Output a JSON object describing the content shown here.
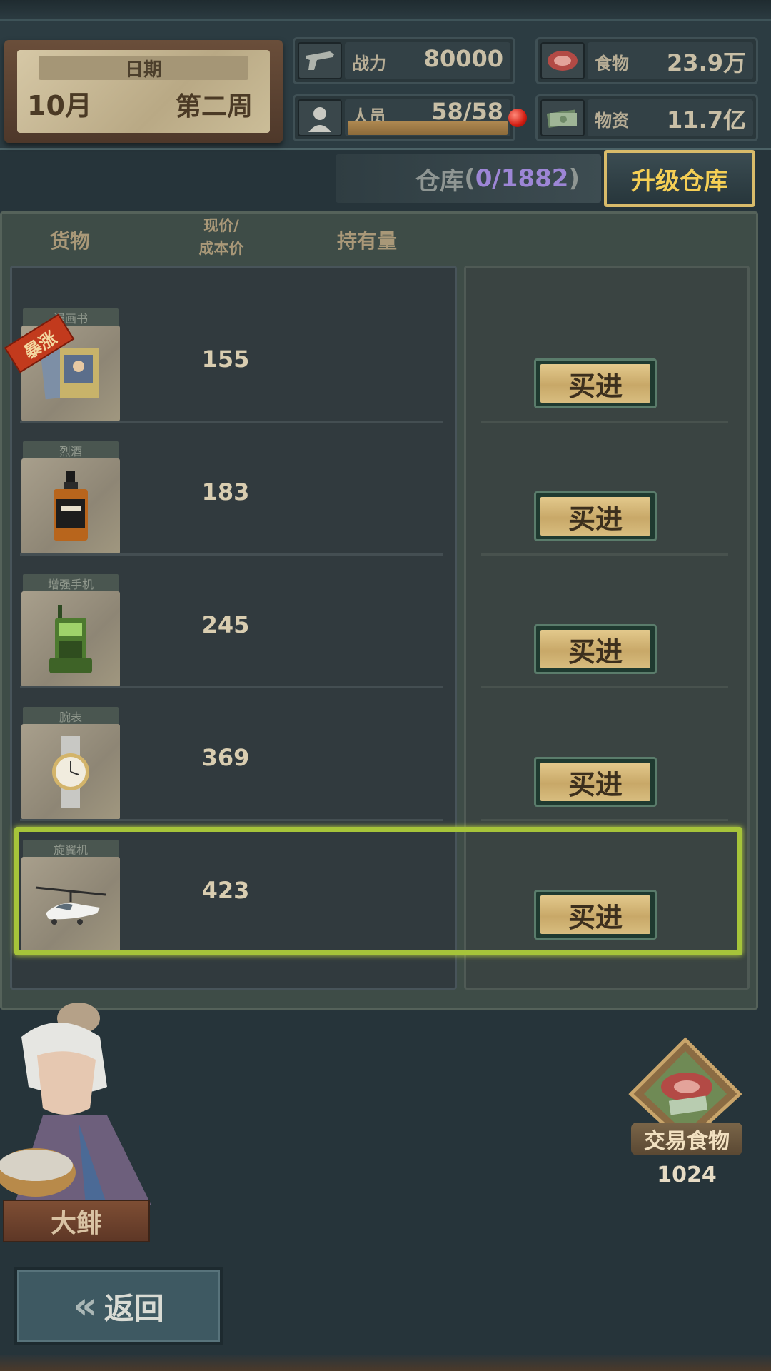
{
  "header": {
    "date_label": "日期",
    "month": "10月",
    "week": "第二周",
    "stats": {
      "combat_label": "战力",
      "combat_value": "80000",
      "staff_label": "人员",
      "staff_value": "58/58",
      "food_label": "食物",
      "food_value": "23.9万",
      "supplies_label": "物资",
      "supplies_value": "11.7亿"
    }
  },
  "warehouse": {
    "label": "仓库",
    "open_paren": "(",
    "count": "0/1882",
    "close_paren": ")",
    "upgrade_label": "升级仓库"
  },
  "table": {
    "headers": {
      "goods": "货物",
      "price_line1": "现价/",
      "price_line2": "成本价",
      "held": "持有量"
    },
    "items": [
      {
        "name": "漫画书",
        "price": "155",
        "buy": "买进",
        "badge": "暴涨"
      },
      {
        "name": "烈酒",
        "price": "183",
        "buy": "买进"
      },
      {
        "name": "增强手机",
        "price": "245",
        "buy": "买进"
      },
      {
        "name": "腕表",
        "price": "369",
        "buy": "买进"
      },
      {
        "name": "旋翼机",
        "price": "423",
        "buy": "买进"
      }
    ]
  },
  "npc": {
    "name": "大鲱"
  },
  "trade": {
    "label": "交易食物",
    "count": "1024"
  },
  "back": {
    "label": "返回"
  }
}
